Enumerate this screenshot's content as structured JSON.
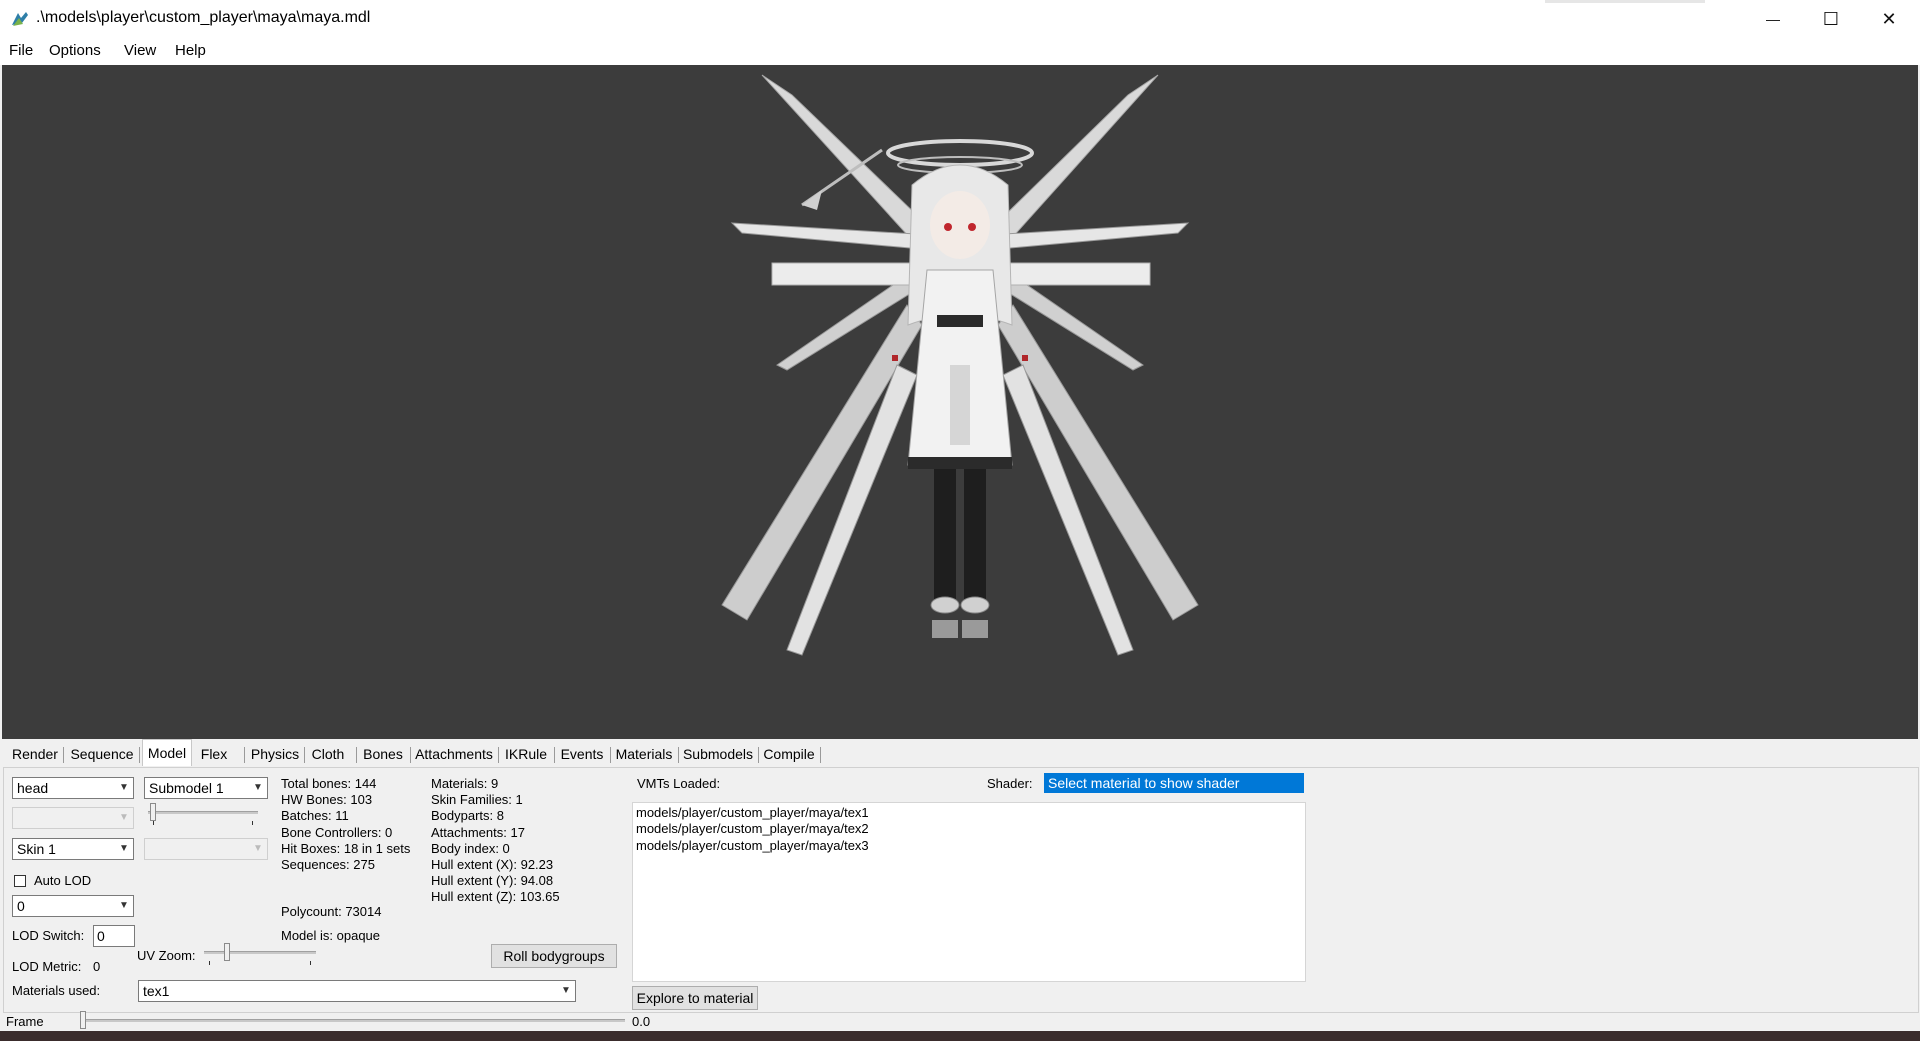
{
  "window": {
    "title": ".\\models\\player\\custom_player\\maya\\maya.mdl",
    "minimize_symbol": "—",
    "maximize_symbol": "☐",
    "close_symbol": "✕"
  },
  "menu": {
    "items": [
      "File",
      "Options",
      "View",
      "Help"
    ]
  },
  "tabs": {
    "items": [
      "Render",
      "Sequence",
      "Model",
      "Flex",
      "Physics",
      "Cloth",
      "Bones",
      "Attachments",
      "IKRule",
      "Events",
      "Materials",
      "Submodels",
      "Compile"
    ],
    "active": "Model"
  },
  "model_panel": {
    "bodypart_select": "head",
    "submodel_select": "Submodel 1",
    "skin_select": "Skin 1",
    "auto_lod_label": "Auto LOD",
    "auto_lod_checked": false,
    "lod_select": "0",
    "lod_switch_label": "LOD Switch:",
    "lod_switch_value": "0",
    "lod_metric_label": "LOD Metric:",
    "lod_metric_value": "0",
    "uv_zoom_label": "UV Zoom:",
    "materials_used_label": "Materials used:",
    "materials_used_value": "tex1",
    "roll_bodygroups_label": "Roll bodygroups"
  },
  "stats_left": [
    "Total bones: 144",
    "HW Bones: 103",
    "Batches: 11",
    "Bone Controllers: 0",
    "Hit Boxes: 18 in 1 sets",
    "Sequences: 275"
  ],
  "polycount": "Polycount: 73014",
  "model_is": "Model is: opaque",
  "stats_right": [
    "Materials: 9",
    "Skin Families: 1",
    "Bodyparts: 8",
    "Attachments: 17",
    "Body index: 0",
    "Hull extent (X): 92.23",
    "Hull extent (Y): 94.08",
    "Hull extent (Z): 103.65"
  ],
  "vmt": {
    "label": "VMTs Loaded:",
    "items": [
      "models/player/custom_player/maya/tex1",
      "models/player/custom_player/maya/tex2",
      "models/player/custom_player/maya/tex3"
    ],
    "explore_button": "Explore to material"
  },
  "shader": {
    "label": "Shader:",
    "value": "Select material to show shader"
  },
  "frame": {
    "label": "Frame",
    "value": "0.0"
  },
  "colors": {
    "viewport_bg": "#3c3c3c",
    "selection_blue": "#0078d7",
    "panel_bg": "#f0f0f0"
  },
  "icons": {
    "app": "hlmv-icon",
    "dropdown": "chevron-down-icon"
  }
}
